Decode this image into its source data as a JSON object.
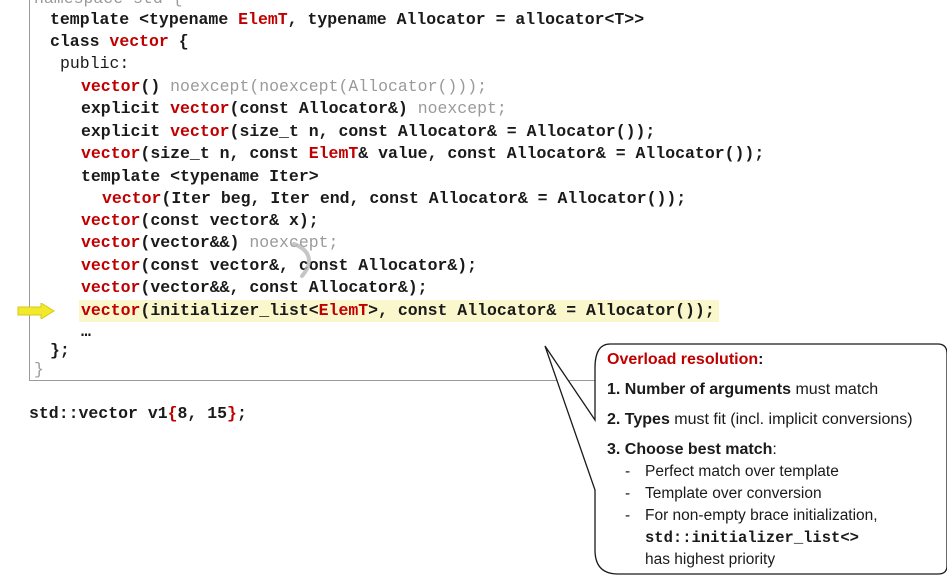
{
  "code": {
    "cut_line": "namespace std {",
    "template_prefix": "template <typename ",
    "elemt": "ElemT",
    "template_suffix": ", typename Allocator = allocator<T>>",
    "class_kw": "class ",
    "class_name": "vector",
    "class_brace": " {",
    "public": "public:",
    "l1_a": "vector",
    "l1_b": "() ",
    "l1_c": "noexcept(noexcept(Allocator()));",
    "l2_a": "explicit ",
    "l2_b": "vector",
    "l2_c": "(const Allocator&) ",
    "l2_d": "noexcept;",
    "l3_a": "explicit ",
    "l3_b": "vector",
    "l3_c": "(size_t n, const Allocator& = Allocator());",
    "l4_a": "vector",
    "l4_b": "(size_t n, const ",
    "l4_c": "ElemT",
    "l4_d": "& value, const Allocator& = Allocator());",
    "l5": "template <typename Iter>",
    "l6_a": "vector",
    "l6_b": "(Iter beg, Iter end, const Allocator& = Allocator());",
    "l7_a": "vector",
    "l7_b": "(const vector& x);",
    "l8_a": "vector",
    "l8_b": "(vector&&) ",
    "l8_c": "noexcept;",
    "l9_a": "vector",
    "l9_b": "(const vector&, const Allocator&);",
    "l10_a": "vector",
    "l10_b": "(vector&&, const Allocator&);",
    "l11_a": "vector",
    "l11_b": "(initializer_list<",
    "l11_c": "ElemT",
    "l11_d": ">, const Allocator& = Allocator());",
    "ellipsis": "…",
    "close_class": "};",
    "close_ns": "}"
  },
  "usage": {
    "a": "std::vector v1",
    "b": "{",
    "c": "8, 15",
    "d": "}",
    "e": ";"
  },
  "callout": {
    "title": "Overload resolution",
    "title_colon": ":",
    "r1_bold": "1. Number of arguments",
    "r1_rest": " must match",
    "r2_bold": "2. Types",
    "r2_rest": " must fit (incl. implicit conversions)",
    "r3_bold": "3. Choose best match",
    "r3_rest": ":",
    "dash": "-",
    "s1": "Perfect match over template",
    "s2": "Template over conversion",
    "s3": "For non-empty brace initialization,",
    "s3_mono": "std::initializer_list<>",
    "s3_end": "has highest priority"
  },
  "colors": {
    "keyword_red": "#c00000",
    "highlight": "#fbf7cc",
    "arrow_yellow": "#f2e92a",
    "muted": "#9a9a9a"
  },
  "icons": {
    "pointer": "arrow-right-icon"
  }
}
